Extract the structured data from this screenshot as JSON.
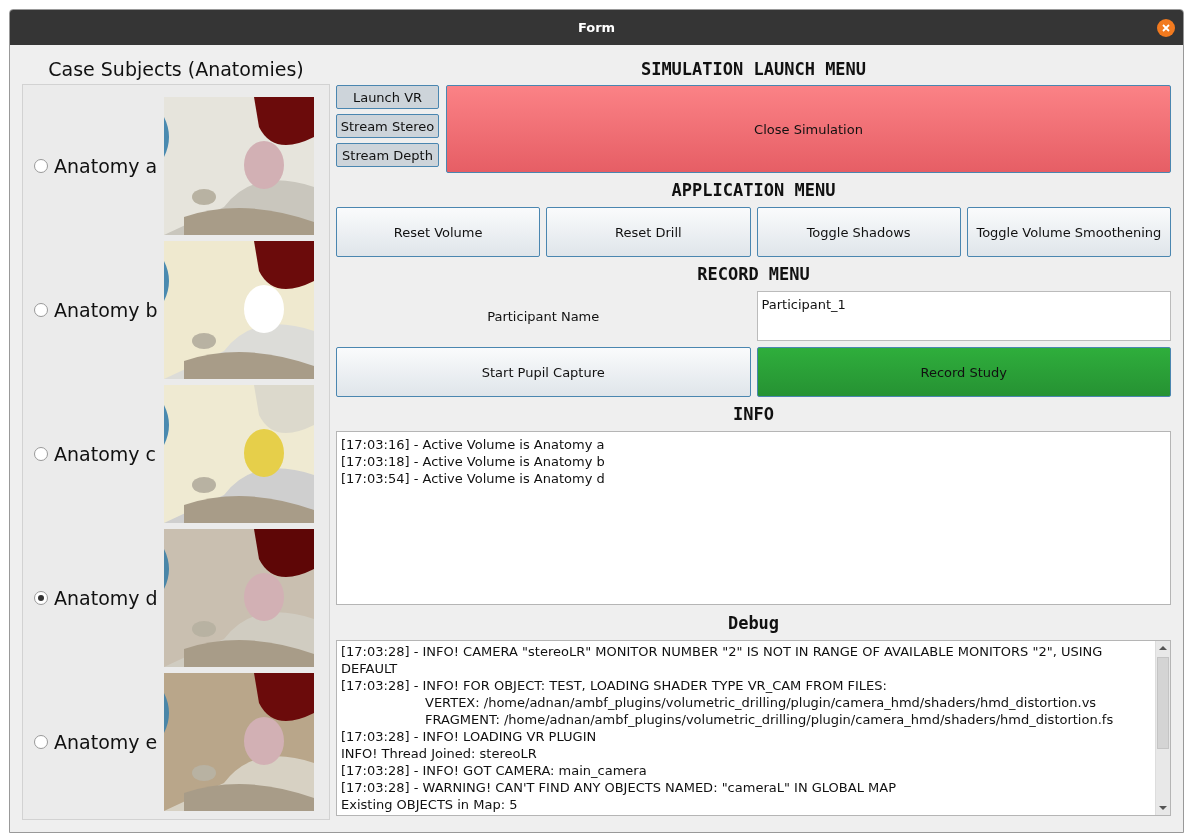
{
  "window": {
    "title": "Form"
  },
  "anatomies": {
    "title": "Case Subjects (Anatomies)",
    "items": [
      {
        "label": "Anatomy a",
        "selected": false
      },
      {
        "label": "Anatomy b",
        "selected": false
      },
      {
        "label": "Anatomy c",
        "selected": false
      },
      {
        "label": "Anatomy d",
        "selected": true
      },
      {
        "label": "Anatomy e",
        "selected": false
      }
    ]
  },
  "simulation": {
    "title": "SIMULATION LAUNCH MENU",
    "small_buttons": [
      "Launch VR",
      "Stream Stereo",
      "Stream Depth"
    ],
    "close_button": "Close Simulation"
  },
  "application": {
    "title": "APPLICATION MENU",
    "buttons": [
      "Reset Volume",
      "Reset Drill",
      "Toggle Shadows",
      "Toggle Volume Smoothening"
    ]
  },
  "record": {
    "title": "RECORD MENU",
    "name_label": "Participant Name",
    "name_value": "Participant_1",
    "capture_button": "Start Pupil Capture",
    "record_button": "Record Study"
  },
  "info": {
    "title": "INFO",
    "lines": [
      "[17:03:16] - Active Volume is Anatomy a",
      "[17:03:18] - Active Volume is Anatomy b",
      "[17:03:54] - Active Volume is Anatomy d"
    ]
  },
  "debug": {
    "title": "Debug",
    "lines": [
      {
        "kind": "line",
        "text": "[17:03:28] - INFO! CAMERA \"stereoLR\" MONITOR NUMBER \"2\" IS NOT IN RANGE OF AVAILABLE MONITORS \"2\", USING DEFAULT"
      },
      {
        "kind": "line",
        "text": "[17:03:28] - INFO! FOR OBJECT: TEST, LOADING SHADER TYPE VR_CAM FROM FILES:"
      },
      {
        "kind": "indented",
        "text": "VERTEX: /home/adnan/ambf_plugins/volumetric_drilling/plugin/camera_hmd/shaders/hmd_distortion.vs"
      },
      {
        "kind": "indented",
        "text": "FRAGMENT: /home/adnan/ambf_plugins/volumetric_drilling/plugin/camera_hmd/shaders/hmd_distortion.fs"
      },
      {
        "kind": "line",
        "text": "[17:03:28] - INFO! LOADING VR PLUGIN"
      },
      {
        "kind": "line",
        "text": "INFO! Thread Joined: stereoLR"
      },
      {
        "kind": "line",
        "text": "[17:03:28] - INFO! GOT CAMERA: main_camera"
      },
      {
        "kind": "line",
        "text": "[17:03:28] - WARNING! CAN'T FIND ANY OBJECTS NAMED: \"cameraL\" IN GLOBAL MAP"
      },
      {
        "kind": "line",
        "text": "Existing OBJECTS in Map: 5"
      }
    ]
  }
}
